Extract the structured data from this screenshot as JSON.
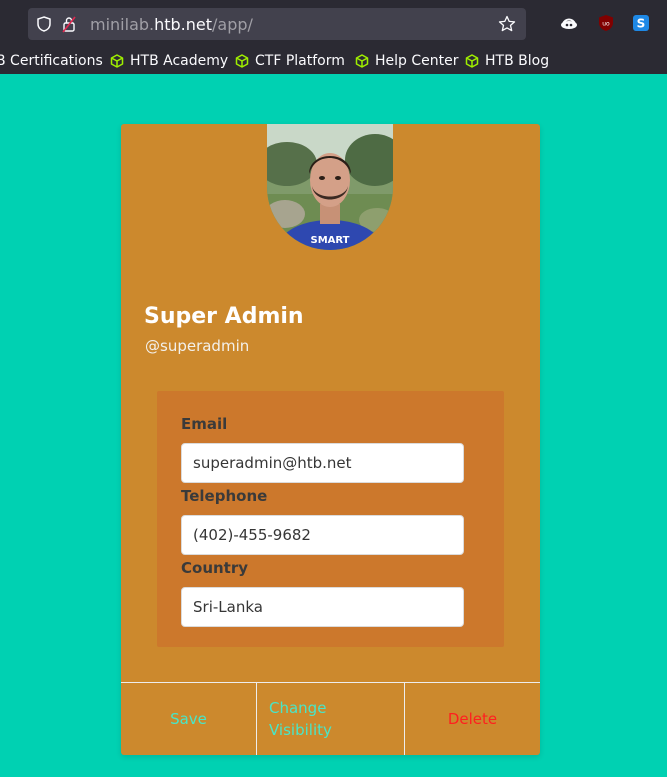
{
  "browser": {
    "url_prefix": "minilab.",
    "url_host": "htb.net",
    "url_path": "/app/",
    "bookmarks": [
      "B Certifications",
      "HTB Academy",
      "CTF Platform",
      "Help Center",
      "HTB Blog"
    ],
    "icons": [
      "shield-icon",
      "lock-icon",
      "star-icon",
      "extension-icon",
      "ublock-icon",
      "s-icon",
      "cube-icon"
    ]
  },
  "profile": {
    "name": "Super Admin",
    "handle": "@superadmin",
    "shirt_text": "SMART"
  },
  "form": {
    "email_label": "Email",
    "email_value": "superadmin@htb.net",
    "telephone_label": "Telephone",
    "telephone_value": "(402)-455-9682",
    "country_label": "Country",
    "country_value": "Sri-Lanka"
  },
  "actions": {
    "save": "Save",
    "change_visibility": "Change Visibility",
    "delete": "Delete"
  },
  "colors": {
    "page_bg": "#00d1b2",
    "card_bg": "#cc892d",
    "info_bg": "#cc782c",
    "action_text": "#48e6c8",
    "delete_text": "#ff1f1f"
  }
}
